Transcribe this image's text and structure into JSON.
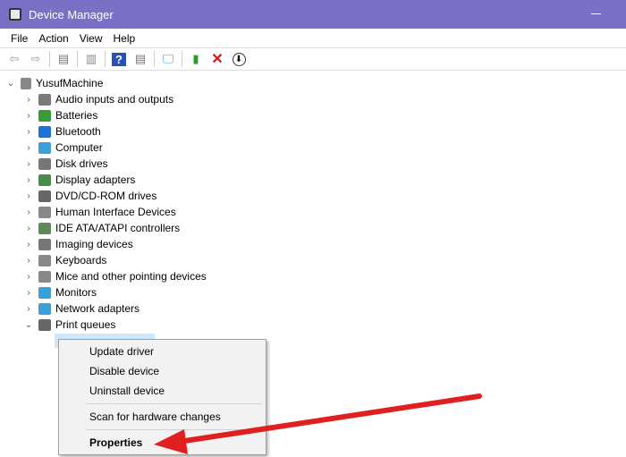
{
  "window": {
    "title": "Device Manager",
    "accent": "#7a70c6"
  },
  "menu": [
    "File",
    "Action",
    "View",
    "Help"
  ],
  "toolbar": [
    "back-icon",
    "forward-icon",
    "show-hide-console-tree-icon",
    "properties-icon",
    "help-icon",
    "action-pane-icon",
    "scan-hardware-icon",
    "update-driver-icon",
    "uninstall-icon",
    "disable-icon"
  ],
  "tree": {
    "root": "YusufMachine",
    "items": [
      {
        "label": "Audio inputs and outputs",
        "color": "#7a7a7a"
      },
      {
        "label": "Batteries",
        "color": "#3a9a3a"
      },
      {
        "label": "Bluetooth",
        "color": "#1e6fd9"
      },
      {
        "label": "Computer",
        "color": "#3aa0d8"
      },
      {
        "label": "Disk drives",
        "color": "#777"
      },
      {
        "label": "Display adapters",
        "color": "#4a8a4a"
      },
      {
        "label": "DVD/CD-ROM drives",
        "color": "#666"
      },
      {
        "label": "Human Interface Devices",
        "color": "#888"
      },
      {
        "label": "IDE ATA/ATAPI controllers",
        "color": "#5a8a5a"
      },
      {
        "label": "Imaging devices",
        "color": "#777"
      },
      {
        "label": "Keyboards",
        "color": "#888"
      },
      {
        "label": "Mice and other pointing devices",
        "color": "#888"
      },
      {
        "label": "Monitors",
        "color": "#3aa0d8"
      },
      {
        "label": "Network adapters",
        "color": "#3aa0d8"
      },
      {
        "label": "Print queues",
        "color": "#666",
        "expanded": true
      }
    ]
  },
  "context_menu": {
    "items": [
      "Update driver",
      "Disable device",
      "Uninstall device",
      "Scan for hardware changes",
      "Properties"
    ]
  },
  "arrow_color": "#e02020"
}
